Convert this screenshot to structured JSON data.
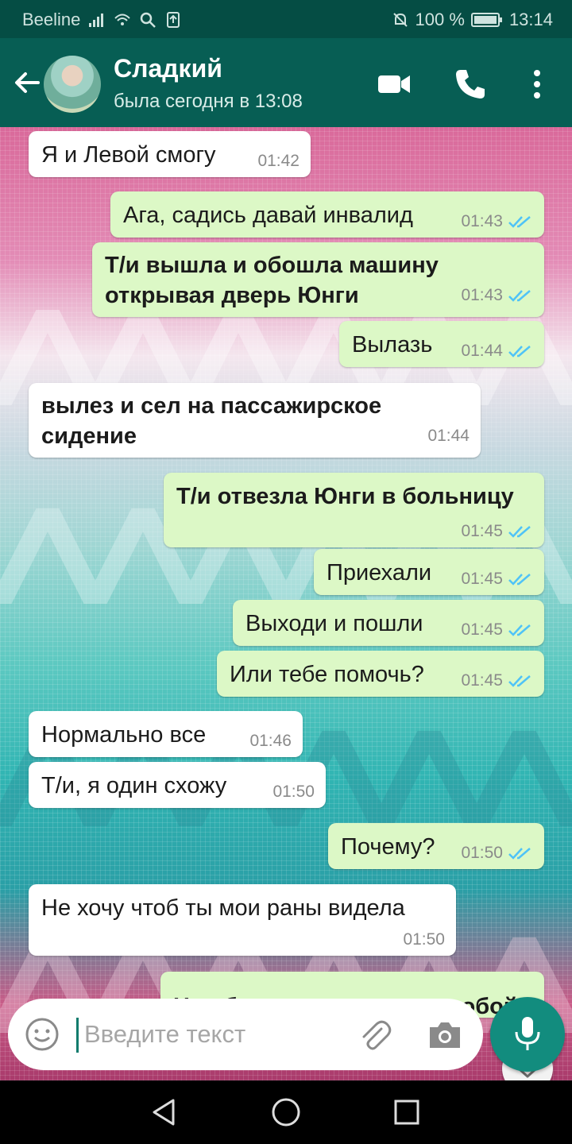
{
  "status_bar": {
    "carrier": "Beeline",
    "battery": "100 %",
    "time": "13:14"
  },
  "header": {
    "contact_name": "Сладкий",
    "contact_status": "была сегодня в 13:08"
  },
  "messages": [
    {
      "dir": "in",
      "text": "Я и Левой смогу",
      "time": "01:42",
      "bold": false
    },
    {
      "dir": "out",
      "text": "Ага, садись давай инвалид",
      "time": "01:43",
      "bold": false
    },
    {
      "dir": "out",
      "text": "Т/и вышла и обошла машину открывая дверь Юнги",
      "time": "01:43",
      "bold": true
    },
    {
      "dir": "out",
      "text": "Вылазь",
      "time": "01:44",
      "bold": false
    },
    {
      "dir": "in",
      "text": "вылез и сел на пассажирское сидение",
      "time": "01:44",
      "bold": true
    },
    {
      "dir": "out",
      "text": "Т/и отвезла Юнги в больницу",
      "time": "01:45",
      "bold": true
    },
    {
      "dir": "out",
      "text": "Приехали",
      "time": "01:45",
      "bold": false
    },
    {
      "dir": "out",
      "text": "Выходи и пошли",
      "time": "01:45",
      "bold": false
    },
    {
      "dir": "out",
      "text": "Или тебе помочь?",
      "time": "01:45",
      "bold": false
    },
    {
      "dir": "in",
      "text": "Нормально все",
      "time": "01:46",
      "bold": false
    },
    {
      "dir": "in",
      "text": "Т/и, я один схожу",
      "time": "01:50",
      "bold": false
    },
    {
      "dir": "out",
      "text": "Почему?",
      "time": "01:50",
      "bold": false
    },
    {
      "dir": "in",
      "text": "Не хочу чтоб ты мои раны видела",
      "time": "01:50",
      "bold": false
    },
    {
      "dir": "out",
      "text": "Не обсуждается я иду с тобой",
      "time": "",
      "bold": true
    }
  ],
  "input": {
    "placeholder": "Введите текст",
    "value": ""
  },
  "colors": {
    "header": "#075e54",
    "status_bar": "#054d44",
    "outgoing_bubble": "#dcf8c6",
    "incoming_bubble": "#ffffff",
    "read_tick": "#4fc3f7",
    "mic_button": "#128c7e"
  },
  "icons": [
    "back-arrow-icon",
    "video-call-icon",
    "phone-icon",
    "more-vert-icon",
    "emoji-icon",
    "attach-icon",
    "camera-icon",
    "mic-icon",
    "scroll-down-icon",
    "nav-back-icon",
    "nav-home-icon",
    "nav-recents-icon"
  ]
}
